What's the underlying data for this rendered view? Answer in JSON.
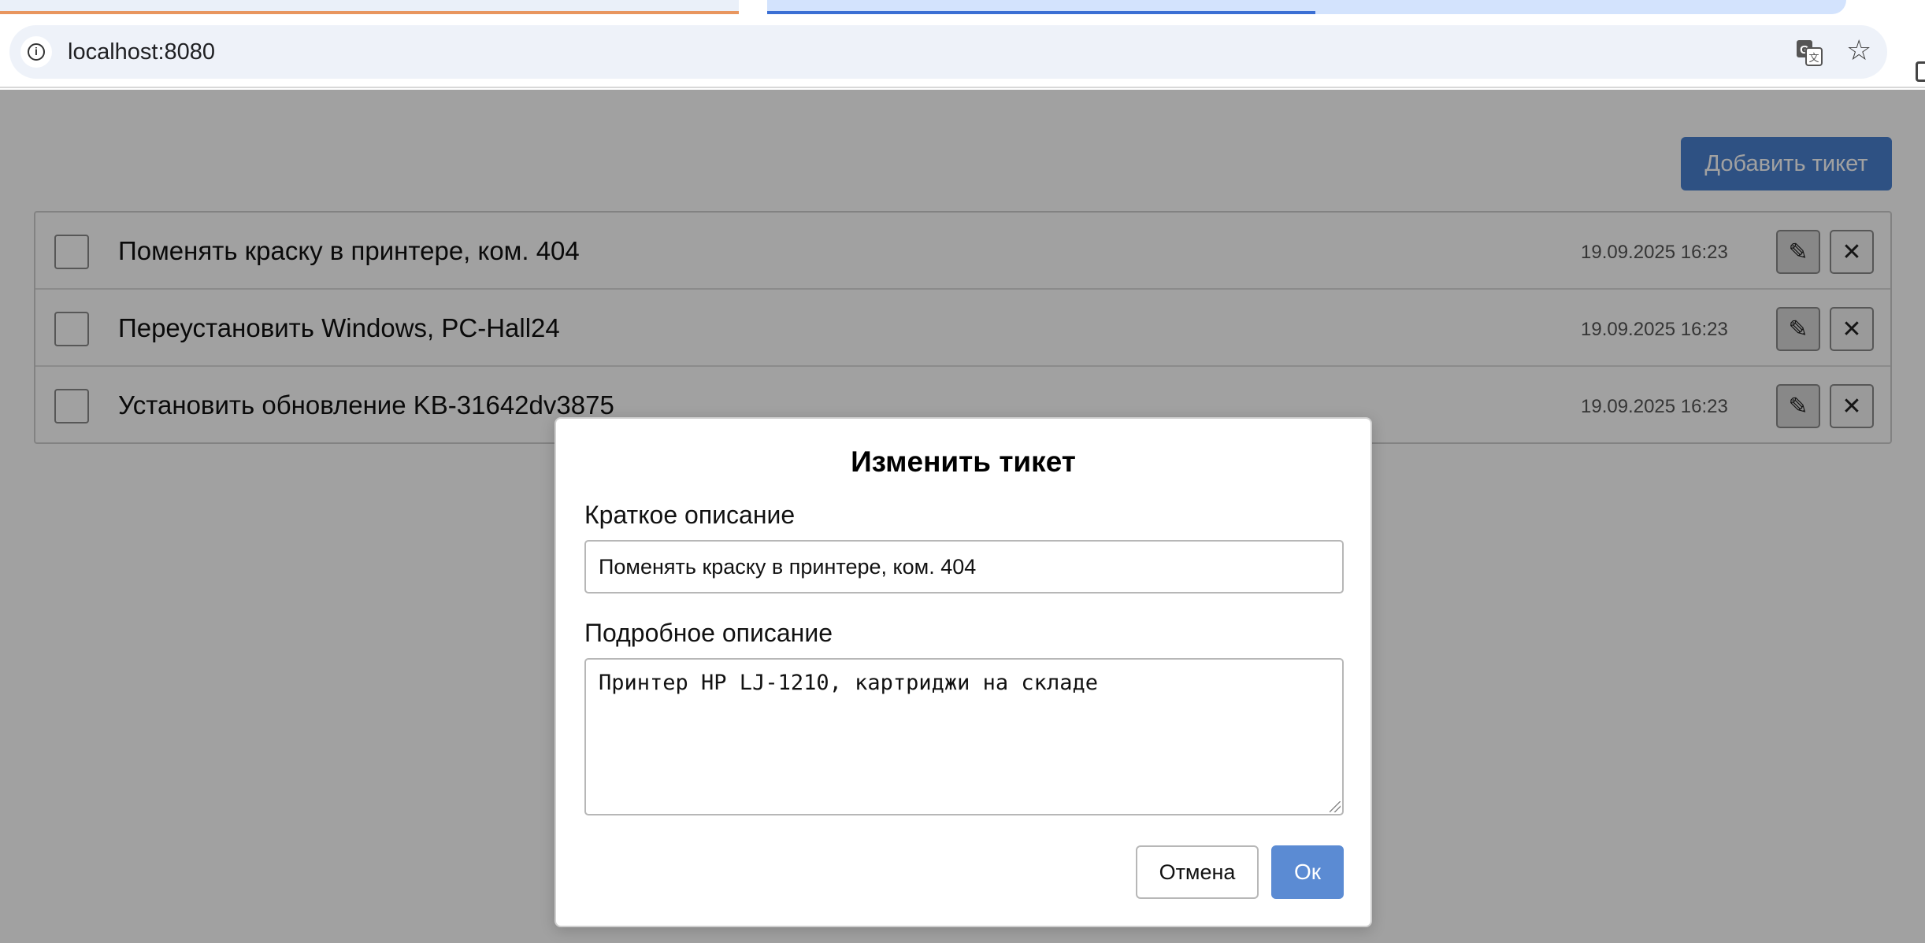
{
  "browser": {
    "url": "localhost:8080",
    "info_icon": "info-icon",
    "translate_icon": "translate-icon",
    "star_icon": "star-icon",
    "active_tab_accent": "#3b6fd4"
  },
  "page": {
    "add_button_label": "Добавить тикет",
    "accent_color": "#4a80d0",
    "tickets": [
      {
        "title": "Поменять краску в принтере, ком. 404",
        "date": "19.09.2025 16:23",
        "checked": false
      },
      {
        "title": "Переустановить Windows, PC-Hall24",
        "date": "19.09.2025 16:23",
        "checked": false
      },
      {
        "title": "Установить обновление KB-31642dv3875",
        "date": "19.09.2025 16:23",
        "checked": false
      }
    ],
    "edit_icon": "pencil-icon",
    "delete_icon": "close-icon"
  },
  "modal": {
    "title": "Изменить тикет",
    "short_label": "Краткое описание",
    "short_value": "Поменять краску в принтере, ком. 404",
    "long_label": "Подробное описание",
    "long_value": "Принтер HP LJ-1210, картриджи на складе",
    "cancel_label": "Отмена",
    "ok_label": "Ок"
  }
}
